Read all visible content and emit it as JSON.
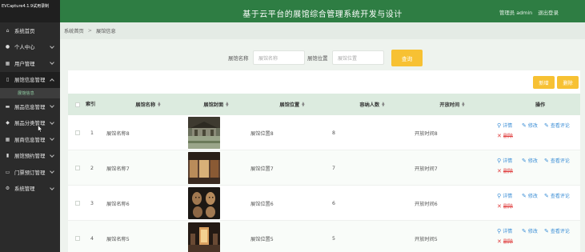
{
  "capture_label": "EVCapture4.1.9试用录制",
  "header": {
    "title": "基于云平台的展馆综合管理系统开发与设计",
    "user_text": "管理员 admin",
    "logout": "退出登录"
  },
  "sidebar": {
    "items": [
      {
        "label": "系统首页",
        "icon": "home-icon"
      },
      {
        "label": "个人中心",
        "icon": "person-icon"
      },
      {
        "label": "用户管理",
        "icon": "users-icon"
      },
      {
        "label": "展馆信息管理",
        "icon": "clipboard-icon"
      },
      {
        "label": "展品信息管理",
        "icon": "monitor-icon"
      },
      {
        "label": "展品分类管理",
        "icon": "tag-icon"
      },
      {
        "label": "展商信息管理",
        "icon": "grid-icon"
      },
      {
        "label": "展馆预约管理",
        "icon": "chart-icon"
      },
      {
        "label": "门票预订管理",
        "icon": "ticket-icon"
      },
      {
        "label": "系统管理",
        "icon": "settings-icon"
      }
    ],
    "submenu_active": "展馆信息"
  },
  "breadcrumb": {
    "home": "系统首页",
    "separator": ">",
    "current": "展馆信息"
  },
  "search": {
    "name_label": "展馆名称",
    "name_placeholder": "展馆名称",
    "location_label": "展馆位置",
    "location_placeholder": "展馆位置",
    "query_button": "查询"
  },
  "actions": {
    "add": "新增",
    "delete": "删除"
  },
  "table": {
    "headers": {
      "index": "索引",
      "name": "展馆名称",
      "cover": "展馆封面",
      "location": "展馆位置",
      "capacity": "容纳人数",
      "open_time": "开放时间",
      "ops": "操作"
    },
    "rows": [
      {
        "index": "1",
        "name": "展馆名称8",
        "location": "展馆位置8",
        "capacity": "8",
        "open_time": "开放时间8"
      },
      {
        "index": "2",
        "name": "展馆名称7",
        "location": "展馆位置7",
        "capacity": "7",
        "open_time": "开放时间7"
      },
      {
        "index": "3",
        "name": "展馆名称6",
        "location": "展馆位置6",
        "capacity": "6",
        "open_time": "开放时间6"
      },
      {
        "index": "4",
        "name": "展馆名称5",
        "location": "展馆位置5",
        "capacity": "5",
        "open_time": "开放时间5"
      }
    ],
    "op_labels": {
      "detail": "详情",
      "edit": "修改",
      "comments": "查看评论",
      "delete": "删除"
    }
  },
  "colors": {
    "header_green": "#2e7d43",
    "sidebar_dark": "#2b2b2b",
    "accent_yellow": "#f7c133",
    "table_head": "#dcebdf",
    "link_blue": "#3d8fd6",
    "delete_red": "#e04040"
  }
}
